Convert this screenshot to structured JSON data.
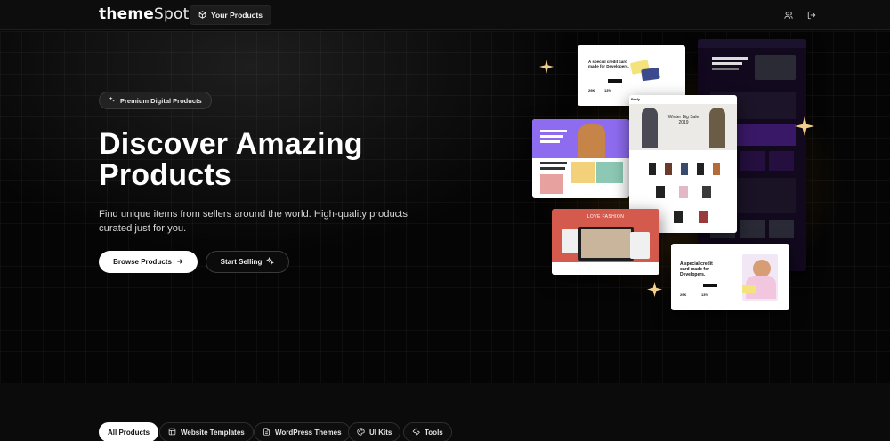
{
  "nav": {
    "logo_bold": "theme",
    "logo_light": "Spot",
    "your_products_label": "Your Products"
  },
  "hero": {
    "badge": "Premium Digital Products",
    "title_line1": "Discover Amazing",
    "title_line2": "Products",
    "subtitle": "Find unique items from sellers around the world. High-quality products curated just for you.",
    "browse_label": "Browse Products",
    "start_selling_label": "Start Selling"
  },
  "collage": {
    "credit_card_title": "A special credit card made for Developers.",
    "winter_title": "Winter Big Sale 2019",
    "love_fashion": "LOVE FASHION",
    "brand_short": "Perfy",
    "stats": [
      "29K",
      "13%"
    ]
  },
  "filters": [
    {
      "label": "All Products",
      "icon": "none",
      "active": true
    },
    {
      "label": "Website Templates",
      "icon": "layout-icon",
      "active": false
    },
    {
      "label": "WordPress Themes",
      "icon": "file-icon",
      "active": false
    },
    {
      "label": "UI Kits",
      "icon": "palette-icon",
      "active": false
    },
    {
      "label": "Tools",
      "icon": "wrench-icon",
      "active": false
    }
  ],
  "colors": {
    "accent_glow": "#cc8c28",
    "background": "#050505",
    "chip_active": "#ffffff"
  }
}
